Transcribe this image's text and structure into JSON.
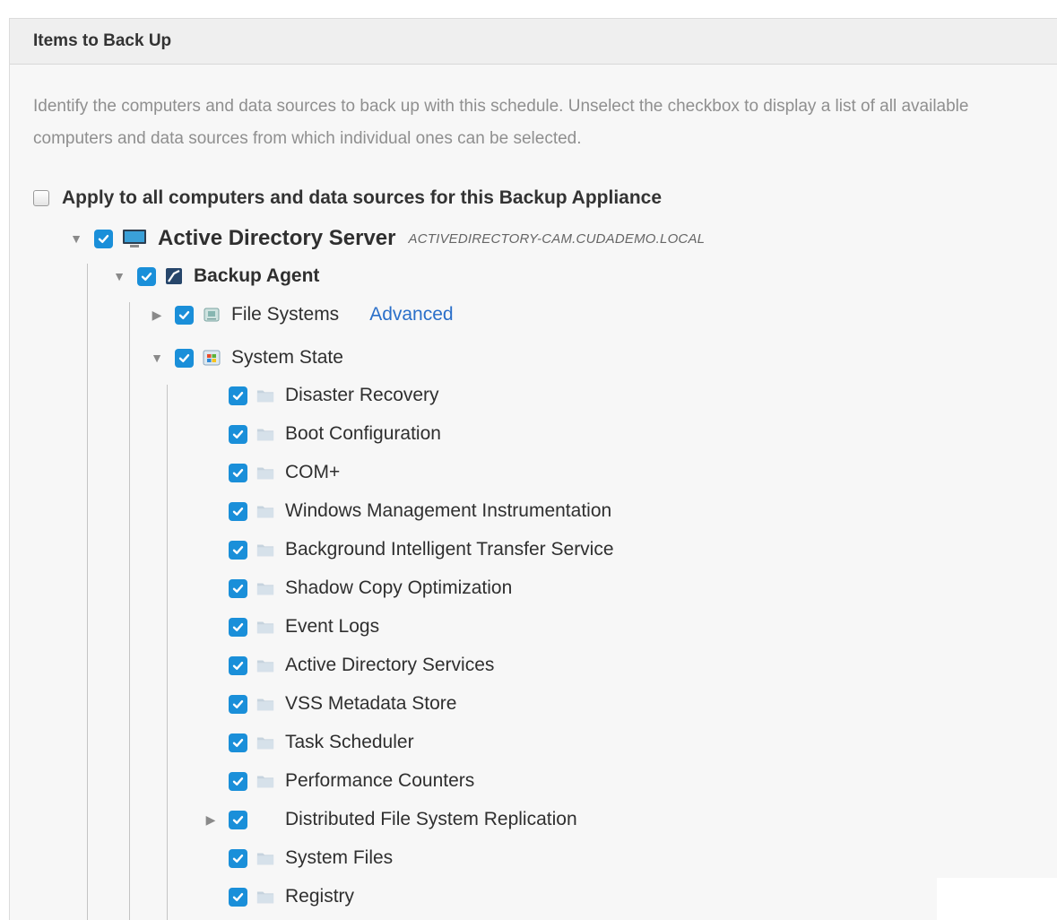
{
  "panel": {
    "title": "Items to Back Up",
    "description": "Identify the computers and data sources to back up with this schedule. Unselect the checkbox to display a list of all available computers and data sources from which individual ones can be selected."
  },
  "apply_all": {
    "label": "Apply to all computers and data sources for this Backup Appliance",
    "checked": false
  },
  "tree": {
    "server": {
      "label": "Active Directory Server",
      "host": "ACTIVEDIRECTORY-CAM.CUDADEMO.LOCAL",
      "expanded": true,
      "checked": true,
      "icon": "monitor-icon"
    },
    "agent": {
      "label": "Backup Agent",
      "expanded": true,
      "checked": true,
      "icon": "backup-agent-icon"
    },
    "file_systems": {
      "label": "File Systems",
      "link": "Advanced",
      "expanded": false,
      "checked": true,
      "icon": "drive-icon"
    },
    "system_state": {
      "label": "System State",
      "expanded": true,
      "checked": true,
      "icon": "windows-icon"
    },
    "system_state_items": [
      {
        "label": "Disaster Recovery",
        "checked": true,
        "icon": "folder-icon"
      },
      {
        "label": "Boot Configuration",
        "checked": true,
        "icon": "folder-icon"
      },
      {
        "label": "COM+",
        "checked": true,
        "icon": "folder-icon"
      },
      {
        "label": "Windows Management Instrumentation",
        "checked": true,
        "icon": "folder-icon"
      },
      {
        "label": "Background Intelligent Transfer Service",
        "checked": true,
        "icon": "folder-icon"
      },
      {
        "label": "Shadow Copy Optimization",
        "checked": true,
        "icon": "folder-icon"
      },
      {
        "label": "Event Logs",
        "checked": true,
        "icon": "folder-icon"
      },
      {
        "label": "Active Directory Services",
        "checked": true,
        "icon": "folder-icon"
      },
      {
        "label": "VSS Metadata Store",
        "checked": true,
        "icon": "folder-icon"
      },
      {
        "label": "Task Scheduler",
        "checked": true,
        "icon": "folder-icon"
      },
      {
        "label": "Performance Counters",
        "checked": true,
        "icon": "folder-icon"
      },
      {
        "label": "Distributed File System Replication",
        "checked": true,
        "expandable": true,
        "icon": "none"
      },
      {
        "label": "System Files",
        "checked": true,
        "icon": "folder-icon"
      },
      {
        "label": "Registry",
        "checked": true,
        "icon": "folder-icon"
      }
    ]
  },
  "colors": {
    "checkbox": "#1a8fd9",
    "link": "#2a6fc9",
    "panel_bg": "#f7f7f7",
    "header_bg": "#efefef"
  }
}
